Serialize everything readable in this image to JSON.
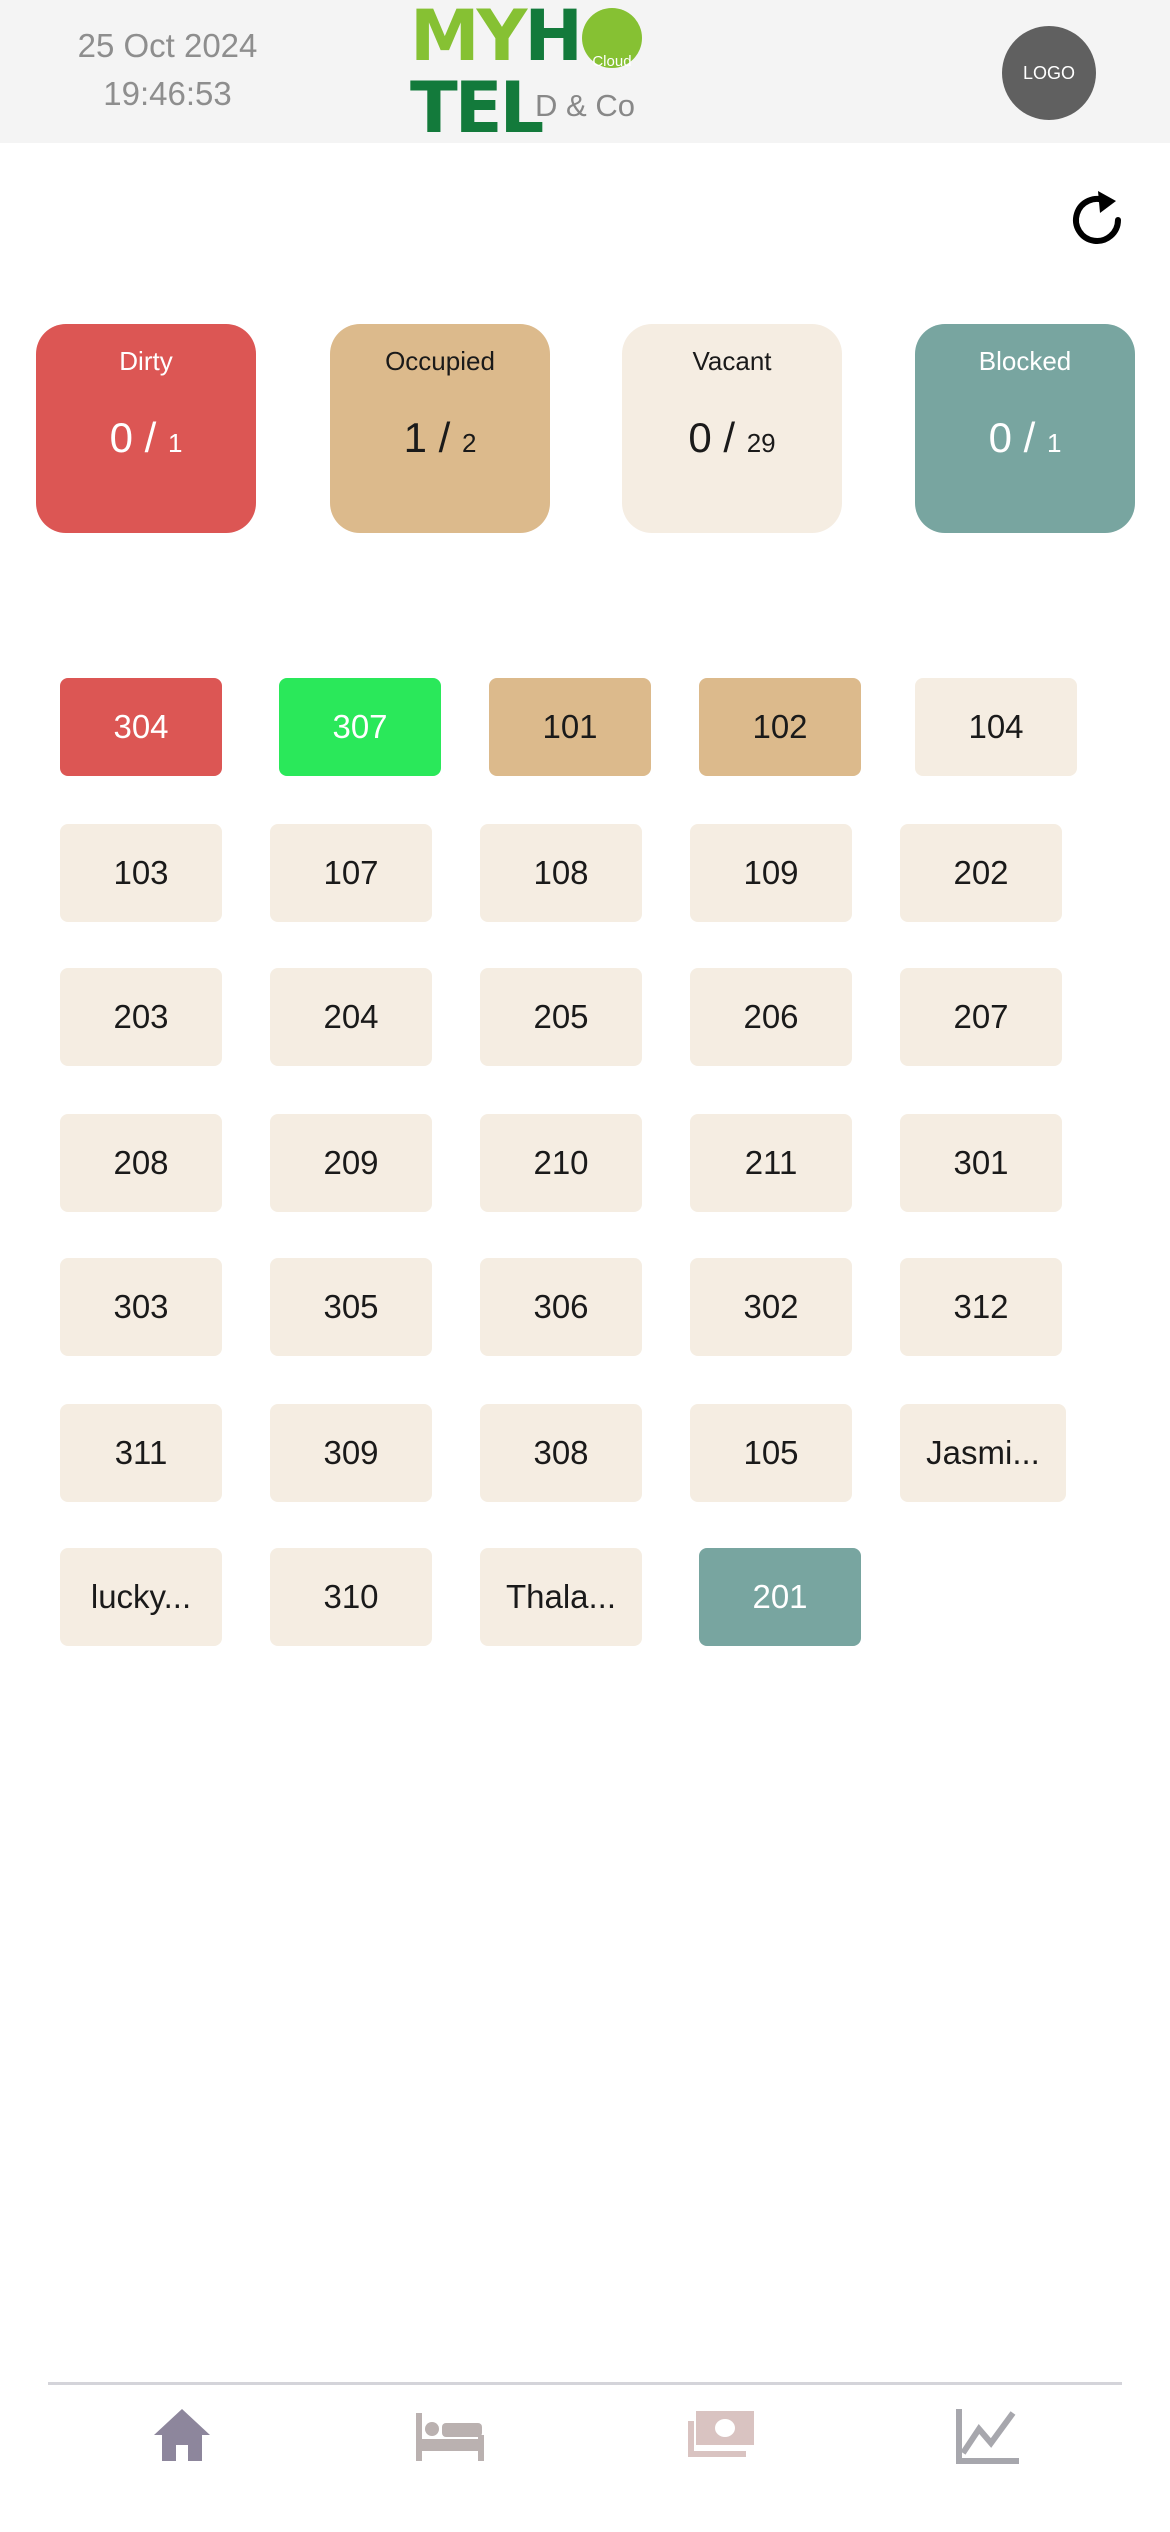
{
  "header": {
    "date": "25 Oct 2024",
    "time": "19:46:53",
    "brand_left": "MY",
    "brand_h": "H",
    "brand_o_badge": "Cloud",
    "brand_right": "TEL",
    "company": "D & Co",
    "logo_label": "LOGO"
  },
  "refresh_icon": "refresh-icon",
  "summary": {
    "dirty": {
      "label": "Dirty",
      "current": "0",
      "sep": " / ",
      "total": "1",
      "color": "#dc5654"
    },
    "occupied": {
      "label": "Occupied",
      "current": "1",
      "sep": " / ",
      "total": "2",
      "color": "#dcba8c"
    },
    "vacant": {
      "label": "Vacant",
      "current": "0",
      "sep": " / ",
      "total": "29",
      "color": "#f5ede2"
    },
    "blocked": {
      "label": "Blocked",
      "current": "0",
      "sep": " / ",
      "total": "1",
      "color": "#78a5a0"
    }
  },
  "rooms": [
    {
      "name": "304",
      "status": "dirty"
    },
    {
      "name": "307",
      "status": "green"
    },
    {
      "name": "101",
      "status": "occupied"
    },
    {
      "name": "102",
      "status": "occupied"
    },
    {
      "name": "104",
      "status": "vacant"
    },
    {
      "name": "103",
      "status": "vacant"
    },
    {
      "name": "107",
      "status": "vacant"
    },
    {
      "name": "108",
      "status": "vacant"
    },
    {
      "name": "109",
      "status": "vacant"
    },
    {
      "name": "202",
      "status": "vacant"
    },
    {
      "name": "203",
      "status": "vacant"
    },
    {
      "name": "204",
      "status": "vacant"
    },
    {
      "name": "205",
      "status": "vacant"
    },
    {
      "name": "206",
      "status": "vacant"
    },
    {
      "name": "207",
      "status": "vacant"
    },
    {
      "name": "208",
      "status": "vacant"
    },
    {
      "name": "209",
      "status": "vacant"
    },
    {
      "name": "210",
      "status": "vacant"
    },
    {
      "name": "211",
      "status": "vacant"
    },
    {
      "name": "301",
      "status": "vacant"
    },
    {
      "name": "303",
      "status": "vacant"
    },
    {
      "name": "305",
      "status": "vacant"
    },
    {
      "name": "306",
      "status": "vacant"
    },
    {
      "name": "302",
      "status": "vacant"
    },
    {
      "name": "312",
      "status": "vacant"
    },
    {
      "name": "311",
      "status": "vacant"
    },
    {
      "name": "309",
      "status": "vacant"
    },
    {
      "name": "308",
      "status": "vacant"
    },
    {
      "name": "105",
      "status": "vacant"
    },
    {
      "name": "Jasmi...",
      "status": "vacant"
    },
    {
      "name": "lucky...",
      "status": "vacant"
    },
    {
      "name": "310",
      "status": "vacant"
    },
    {
      "name": "Thala...",
      "status": "vacant"
    },
    {
      "name": "201",
      "status": "blocked"
    }
  ],
  "nav": [
    {
      "icon": "home-icon"
    },
    {
      "icon": "bed-icon"
    },
    {
      "icon": "money-icon"
    },
    {
      "icon": "chart-icon"
    }
  ]
}
